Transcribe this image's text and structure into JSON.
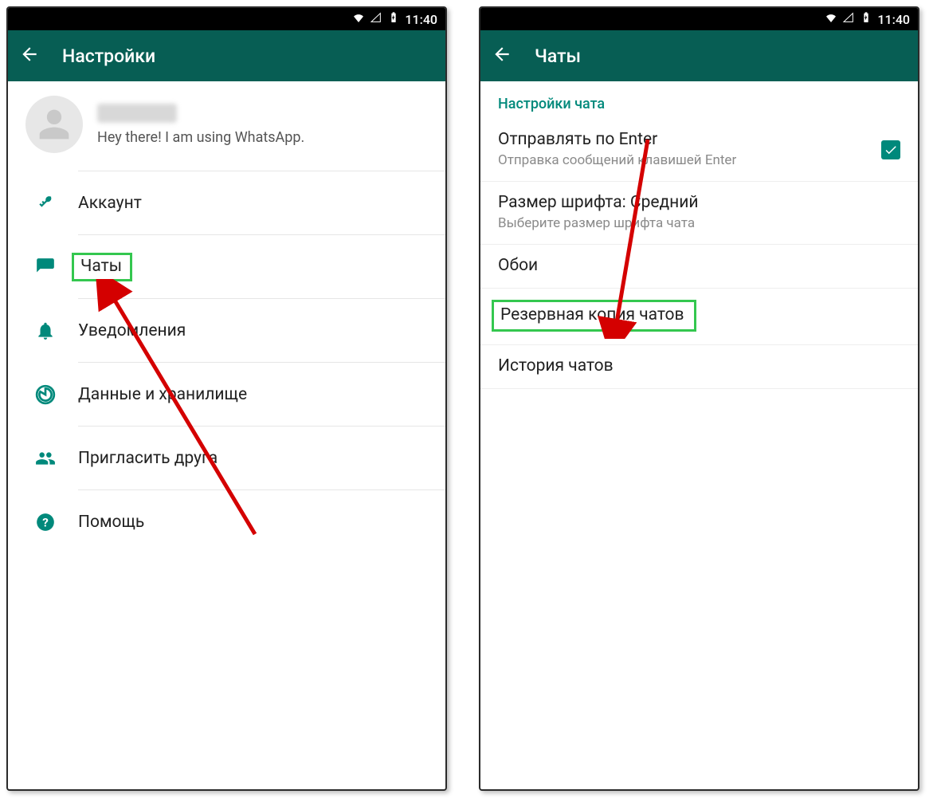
{
  "statusbar": {
    "time": "11:40"
  },
  "left": {
    "appbar_title": "Настройки",
    "profile_status": "Hey there! I am using WhatsApp.",
    "items": {
      "account": "Аккаунт",
      "chats": "Чаты",
      "notifications": "Уведомления",
      "data": "Данные и хранилище",
      "invite": "Пригласить друга",
      "help": "Помощь"
    }
  },
  "right": {
    "appbar_title": "Чаты",
    "section": "Настройки чата",
    "enter": {
      "primary": "Отправлять по Enter",
      "secondary": "Отправка сообщений клавишей Enter",
      "checked": true
    },
    "font": {
      "primary": "Размер шрифта: Средний",
      "secondary": "Выберите размер шрифта чата"
    },
    "wallpaper": {
      "primary": "Обои"
    },
    "backup": {
      "primary": "Резервная копия чатов"
    },
    "history": {
      "primary": "История чатов"
    }
  }
}
